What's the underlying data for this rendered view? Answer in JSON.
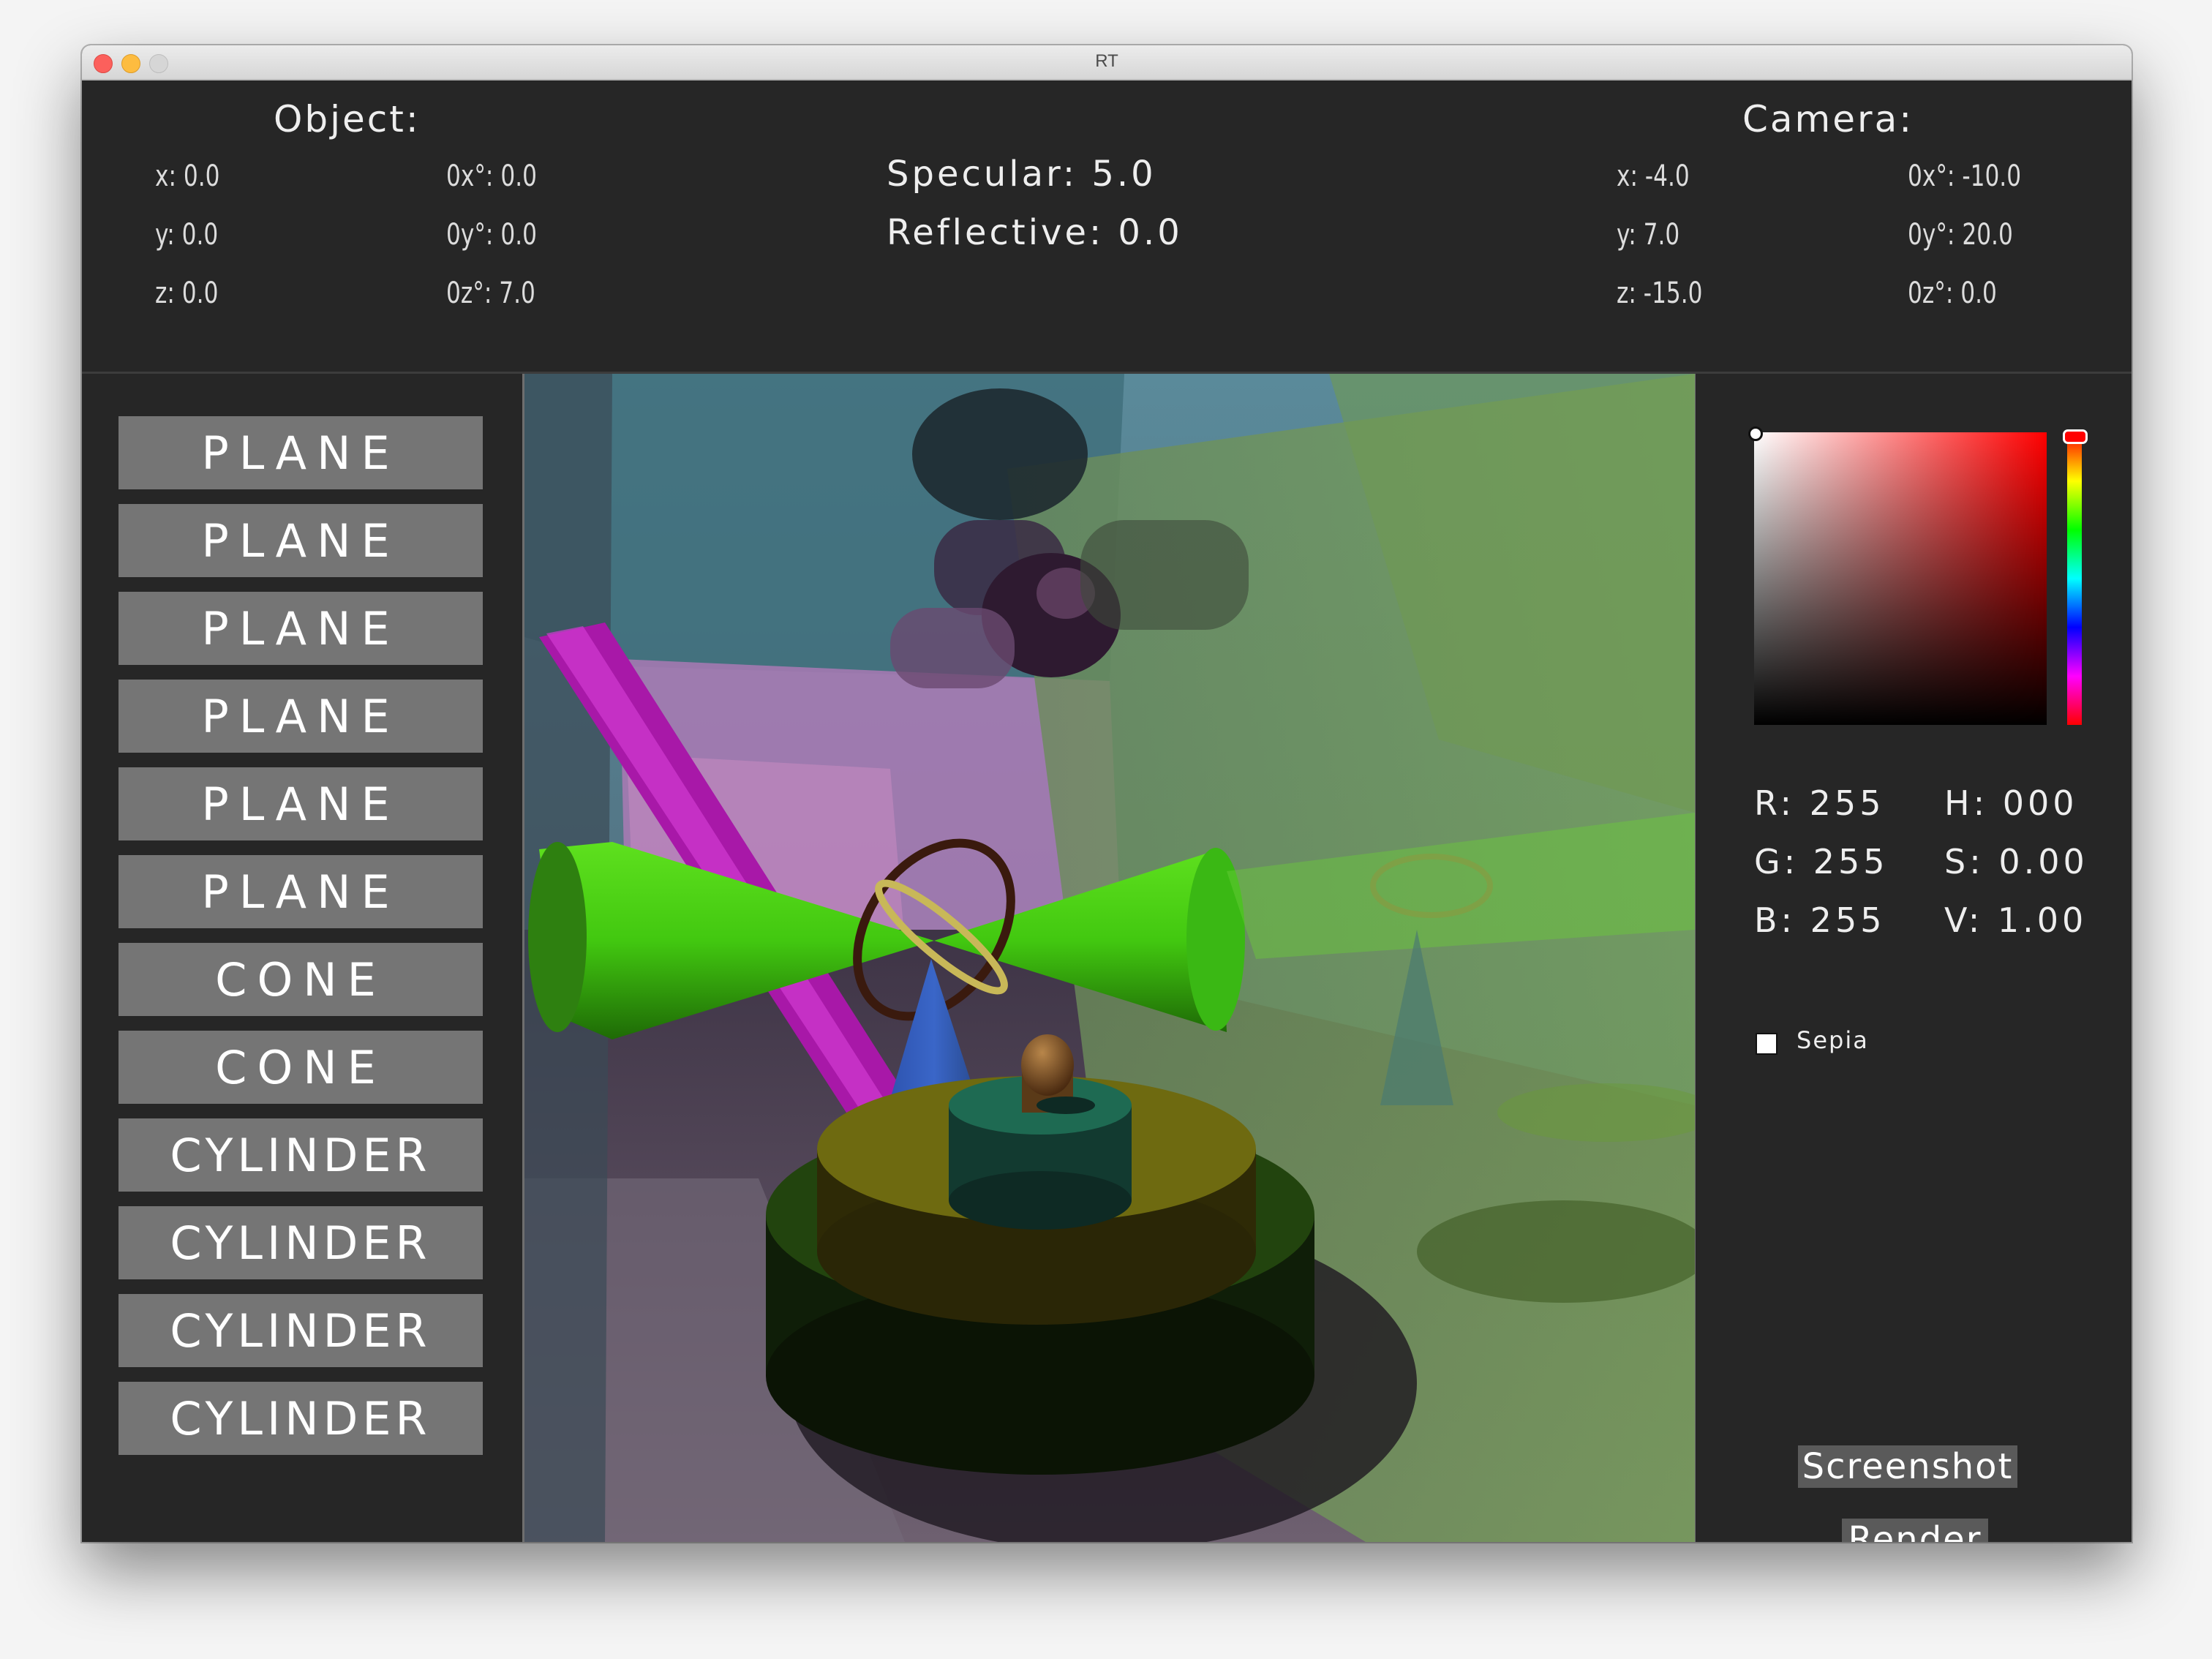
{
  "window": {
    "title": "RT"
  },
  "object": {
    "heading": "Object:",
    "x": "x: 0.0",
    "y": "y: 0.0",
    "z": "z: 0.0",
    "rx": "0x°: 0.0",
    "ry": "0y°: 0.0",
    "rz": "0z°: 7.0"
  },
  "material": {
    "specular": "Specular: 5.0",
    "reflective": "Reflective: 0.0"
  },
  "camera": {
    "heading": "Camera:",
    "x": "x: -4.0",
    "y": "y: 7.0",
    "z": "z: -15.0",
    "rx": "0x°: -10.0",
    "ry": "0y°: 20.0",
    "rz": "0z°: 0.0"
  },
  "objects": [
    {
      "label": "PLANE"
    },
    {
      "label": "PLANE"
    },
    {
      "label": "PLANE"
    },
    {
      "label": "PLANE"
    },
    {
      "label": "PLANE"
    },
    {
      "label": "PLANE"
    },
    {
      "label": "CONE"
    },
    {
      "label": "CONE"
    },
    {
      "label": "CYLINDER"
    },
    {
      "label": "CYLINDER"
    },
    {
      "label": "CYLINDER"
    },
    {
      "label": "CYLINDER"
    }
  ],
  "color": {
    "r": "R: 255",
    "g": "G: 255",
    "b": "B: 255",
    "h": "H: 000",
    "s": "S: 0.00",
    "v": "V: 1.00",
    "hue_color": "#ff0000"
  },
  "sepia": {
    "label": "Sepia",
    "checked": false
  },
  "buttons": {
    "screenshot": "Screenshot",
    "render": "Render"
  }
}
